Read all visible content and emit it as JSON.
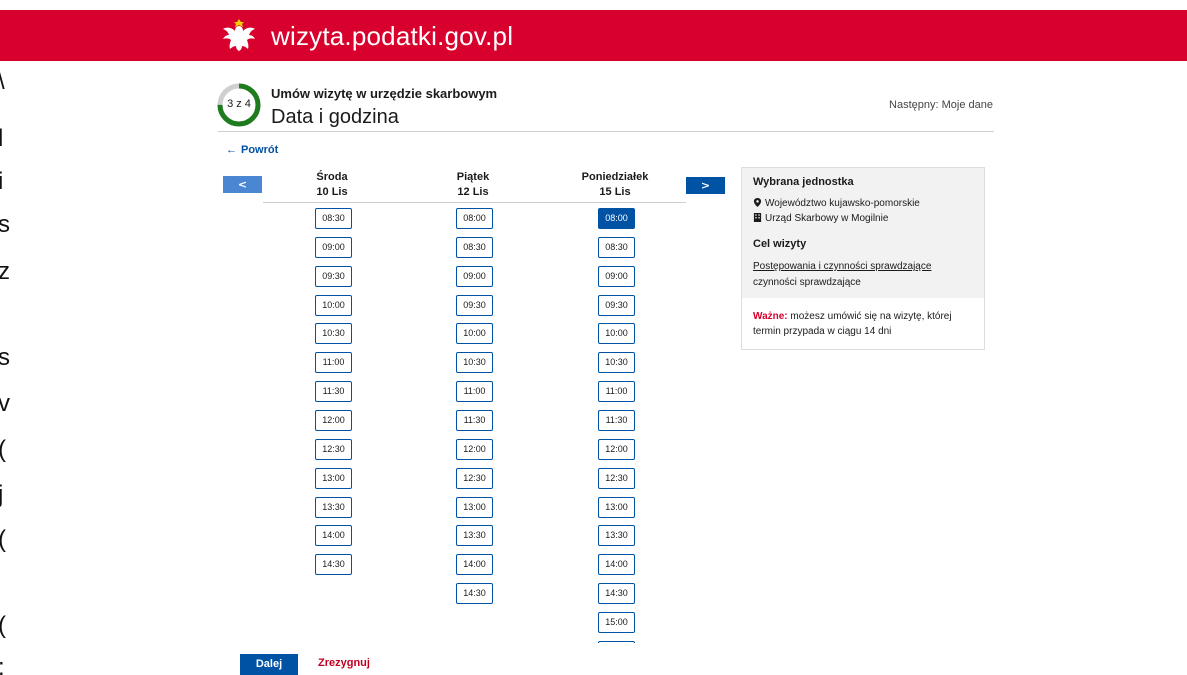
{
  "site": {
    "title": "wizyta.podatki.gov.pl"
  },
  "left_edge": [
    "\\",
    "l",
    "i",
    "s",
    "z",
    "s",
    "v",
    "(",
    "j",
    "(",
    "(",
    ":"
  ],
  "header": {
    "step": "3 z 4",
    "step_progress": 0.75,
    "subtitle": "Umów wizytę w urzędzie skarbowym",
    "title": "Data i godzina",
    "next_step": "Następny: Moje dane"
  },
  "back_label": "Powrót",
  "nav": {
    "prev_label": "<",
    "next_label": ">"
  },
  "days": [
    {
      "name": "Środa",
      "date": "10 Lis",
      "slots": [
        "08:30",
        "09:00",
        "09:30",
        "10:00",
        "10:30",
        "11:00",
        "11:30",
        "12:00",
        "12:30",
        "13:00",
        "13:30",
        "14:00",
        "14:30"
      ]
    },
    {
      "name": "Piątek",
      "date": "12 Lis",
      "slots": [
        "08:00",
        "08:30",
        "09:00",
        "09:30",
        "10:00",
        "10:30",
        "11:00",
        "11:30",
        "12:00",
        "12:30",
        "13:00",
        "13:30",
        "14:00",
        "14:30"
      ]
    },
    {
      "name": "Poniedziałek",
      "date": "15 Lis",
      "slots": [
        "08:00",
        "08:30",
        "09:00",
        "09:30",
        "10:00",
        "10:30",
        "11:00",
        "11:30",
        "12:00",
        "12:30",
        "13:00",
        "13:30",
        "14:00",
        "14:30",
        "15:00",
        ""
      ]
    }
  ],
  "selected_slot": {
    "day": 2,
    "time": "08:00"
  },
  "panel": {
    "unit_heading": "Wybrana jednostka",
    "voivodeship": "Województwo kujawsko-pomorskie",
    "office": "Urząd Skarbowy w Mogilnie",
    "purpose_heading": "Cel wizyty",
    "purpose_link": "Postępowania i czynności sprawdzające",
    "purpose_detail": "czynności sprawdzające",
    "important_label": "Ważne:",
    "important_text": " możesz umówić się na wizytę, której termin przypada w ciągu 14 dni"
  },
  "actions": {
    "next": "Dalej",
    "cancel": "Zrezygnuj"
  },
  "colors": {
    "brand_red": "#d8002c",
    "primary_blue": "#0052a5",
    "progress_green": "#1e7b1e"
  },
  "icons": {
    "emblem": "polish-eagle-icon",
    "location": "map-pin-icon",
    "office": "building-icon",
    "back": "arrow-left-icon"
  }
}
